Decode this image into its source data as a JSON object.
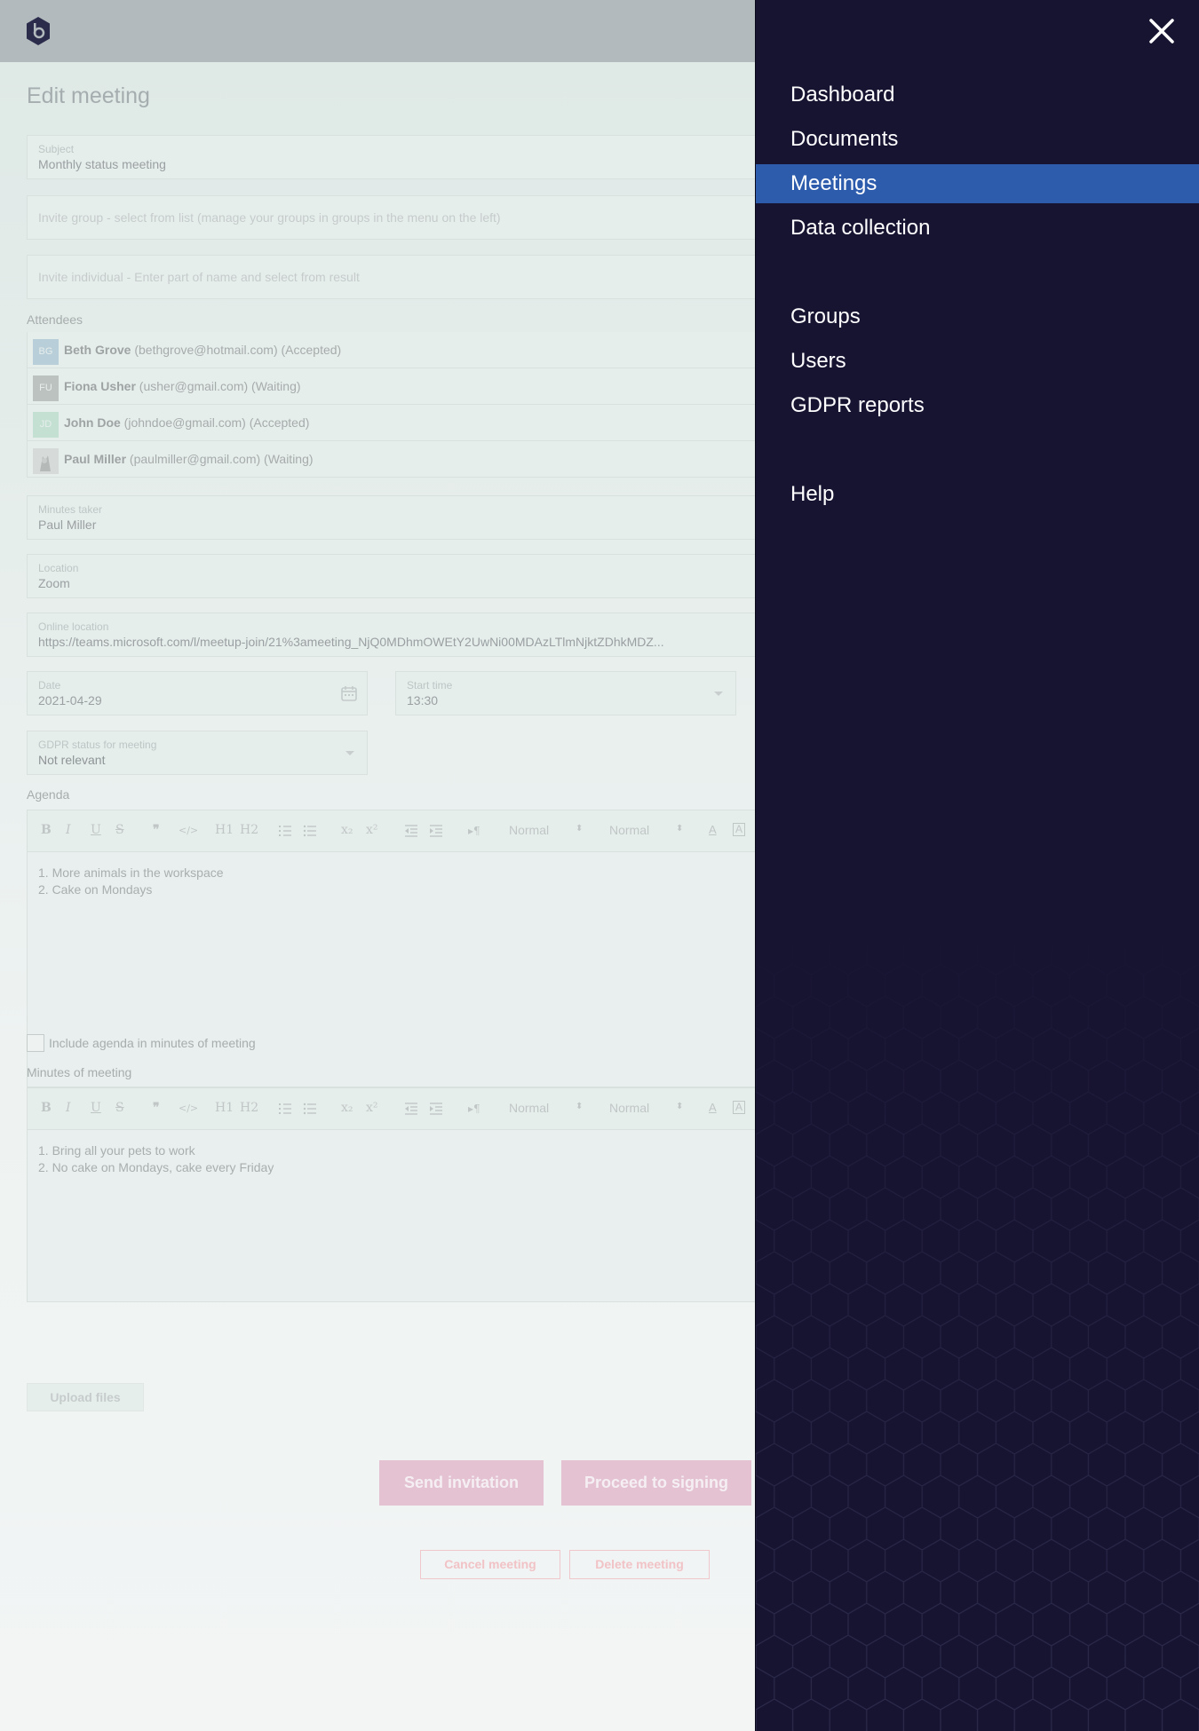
{
  "app": {
    "logo": "hexagon-logo"
  },
  "page": {
    "title": "Edit meeting"
  },
  "subject": {
    "label": "Subject",
    "value": "Monthly status meeting"
  },
  "invite_group": {
    "placeholder": "Invite group - select from list (manage your groups in groups in the menu on the left)"
  },
  "invite_individual": {
    "placeholder": "Invite individual - Enter part of name and select from result"
  },
  "attendees": {
    "label": "Attendees",
    "items": [
      {
        "initials": "BG",
        "name": "Beth Grove",
        "detail": "(bethgrove@hotmail.com) (Accepted)",
        "color": "#b8ced8"
      },
      {
        "initials": "FU",
        "name": "Fiona Usher",
        "detail": "(usher@gmail.com) (Waiting)",
        "color": "#bcc2c0"
      },
      {
        "initials": "JD",
        "name": "John Doe",
        "detail": "(johndoe@gmail.com) (Accepted)",
        "color": "#c3e0d2"
      },
      {
        "initials": "",
        "name": "Paul Miller",
        "detail": "(paulmiller@gmail.com) (Waiting)",
        "color": "#d6dad8"
      }
    ]
  },
  "minutes_taker": {
    "label": "Minutes taker",
    "value": "Paul Miller"
  },
  "location": {
    "label": "Location",
    "value": "Zoom"
  },
  "online_location": {
    "label": "Online location",
    "value": "https://teams.microsoft.com/l/meetup-join/21%3ameeting_NjQ0MDhmOWEtY2UwNi00MDAzLTlmNjktZDhkMDZ..."
  },
  "date": {
    "label": "Date",
    "value": "2021-04-29"
  },
  "start_time": {
    "label": "Start time",
    "value": "13:30"
  },
  "gdpr": {
    "label": "GDPR status for meeting",
    "value": "Not relevant"
  },
  "toolbar": {
    "bold": "B",
    "italic": "I",
    "underline": "U",
    "strike": "S",
    "quote": "❞",
    "code": "</>",
    "h1": "H1",
    "h2": "H2",
    "sub": "x₂",
    "sup": "x²",
    "indent_dir": "▸¶",
    "font_select": "Normal",
    "size_select": "Normal",
    "color": "A",
    "bg_color": "A"
  },
  "agenda": {
    "label": "Agenda",
    "line1": "1. More animals in the workspace",
    "line2": "2. Cake on Mondays"
  },
  "include_agenda": {
    "label": "Include agenda in minutes of meeting"
  },
  "minutes": {
    "label": "Minutes of meeting",
    "line1": "1. Bring all your pets to work",
    "line2": "2. No cake on Mondays, cake every Friday"
  },
  "buttons": {
    "upload": "Upload files",
    "send_invitation": "Send invitation",
    "proceed_signing": "Proceed to signing",
    "cancel_meeting": "Cancel meeting",
    "delete_meeting": "Delete meeting"
  },
  "nav": {
    "items": [
      {
        "label": "Dashboard",
        "active": false
      },
      {
        "label": "Documents",
        "active": false
      },
      {
        "label": "Meetings",
        "active": true
      },
      {
        "label": "Data collection",
        "active": false
      },
      {
        "label": "Groups",
        "active": false
      },
      {
        "label": "Users",
        "active": false
      },
      {
        "label": "GDPR reports",
        "active": false
      },
      {
        "label": "Help",
        "active": false
      }
    ]
  },
  "colors": {
    "sidebar_bg": "#171432",
    "active_nav": "#2d5cad",
    "primary_button": "#e4c2d2",
    "danger_outline": "#f0c8cc"
  }
}
